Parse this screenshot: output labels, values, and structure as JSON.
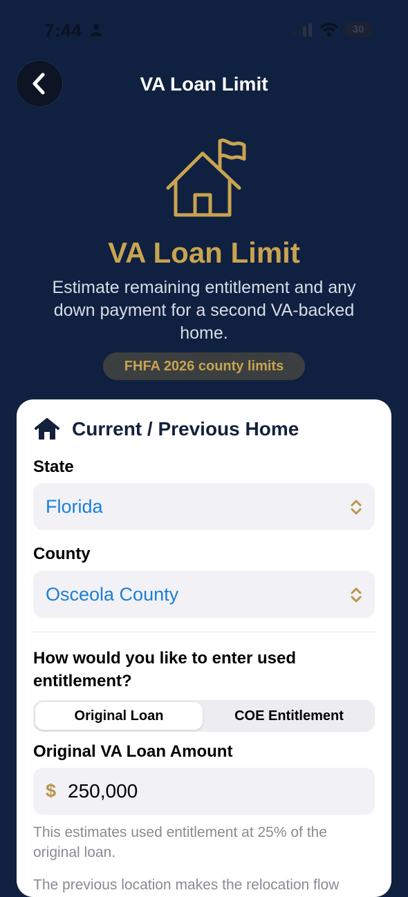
{
  "status_bar": {
    "time": "7:44",
    "battery": "30"
  },
  "nav": {
    "title": "VA Loan Limit",
    "back_icon": "chevron-left-icon"
  },
  "hero": {
    "icon": "house-flag-icon",
    "title": "VA Loan Limit",
    "subtitle": "Estimate remaining entitlement and any down payment for a second VA-backed home.",
    "badge": "FHFA 2026 county limits"
  },
  "card": {
    "header_icon": "house-icon",
    "title": "Current / Previous Home",
    "state": {
      "label": "State",
      "value": "Florida"
    },
    "county": {
      "label": "County",
      "value": "Osceola County"
    },
    "question": "How would you like to enter used entitlement?",
    "segments": [
      {
        "label": "Original Loan",
        "selected": true
      },
      {
        "label": "COE Entitlement",
        "selected": false
      }
    ],
    "amount": {
      "label": "Original VA Loan Amount",
      "currency": "$",
      "value": "250,000"
    },
    "help_text": "This estimates used entitlement at 25% of the original loan.",
    "help_text_2": "The previous location makes the relocation flow"
  },
  "colors": {
    "background": "#102040",
    "gold": "#c8a450",
    "link_blue": "#1a7fd6"
  }
}
